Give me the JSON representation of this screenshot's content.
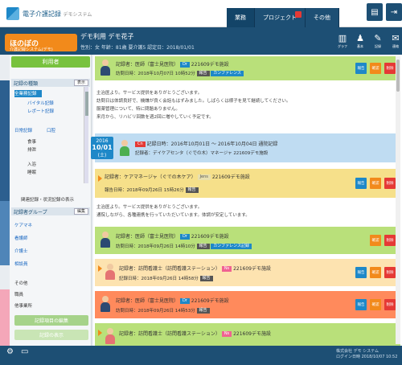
{
  "app": {
    "title": "電子介護記録",
    "subtitle": "デモシステム"
  },
  "tabs": [
    {
      "label": "業務"
    },
    {
      "label": "プロジェクト"
    },
    {
      "label": "その他"
    }
  ],
  "header": {
    "brand": "ほのぼの",
    "brand_sub": "介護記録システム(デモ)",
    "customer_name": "デモ利用 デモ花子",
    "customer_info": "性別：女 年齢：81歳 要介護5 認定日：2018/01/01",
    "icons": [
      {
        "icon": "chart-icon",
        "label": "グラフ"
      },
      {
        "icon": "person-icon",
        "label": "基本"
      },
      {
        "icon": "pen-icon",
        "label": "記録"
      },
      {
        "icon": "mail-icon",
        "label": "連絡"
      }
    ]
  },
  "sidebar": {
    "new_button": "利用者",
    "section1_title": "記録の種類",
    "section1_btn": "表示",
    "items1": [
      "全業務記録",
      "バイタル記録",
      "レポート記録",
      "日常記録",
      "口腔",
      "食事",
      "排泄",
      "入浴",
      "睡眠"
    ],
    "filter_label": "関連記録・状況記録の表示",
    "section2_title": "記録者グループ",
    "section2_btn": "編集",
    "items2": [
      "ケアマネ",
      "看護師",
      "介護士",
      "相談員"
    ],
    "items3": [
      "その他",
      "職員",
      "他事業所"
    ],
    "green1": "記録項目の編集",
    "green2": "記録の表示"
  },
  "timeline": [
    {
      "color": "#b9e07a",
      "l1": "記録者：医師（富士見医院）",
      "tag": "Dr",
      "l1b": "221609デモ施設",
      "l2": "訪問日時：2018年10月07日 10時52分",
      "l2tag": "報告",
      "l2tag2": "カンファレンス"
    },
    {
      "color": "#ffffff",
      "note": true
    },
    {
      "color": "#bfdcf2",
      "l1": "記録日時：2016年10月01日 ～ 2016年10月04日 通院記録",
      "l2": "記録者：デイケアセンタ（ぐでの木）マネージャ",
      "tag": "Cn",
      "l1b": "221609デモ施設"
    },
    {
      "color": "#f6e08a",
      "l1": "記録者：ケアマネージャ（ぐでの木ケア）",
      "tag": "Jens",
      "l1b": "221609デモ施設",
      "l2": "報告日時：2018年09月26日 15時26分",
      "l2tag": "報告"
    },
    {
      "color": "#ffffff",
      "note2": true
    },
    {
      "color": "#b9e07a",
      "l1": "記録者：医師（富士見医院）",
      "tag": "Dr",
      "l1b": "221609デモ施設",
      "l2": "訪問日時：2018年09月26日 14時10分",
      "l2tag": "報告",
      "l2tag2": "カンファレンス記録"
    },
    {
      "color": "#fde3b0",
      "l1": "記録者：訪問看護士（訪問看護ステーション）",
      "tag": "Ns",
      "l1b": "221609デモ施設",
      "l2": "記録日時：2018年09月26日 14時58分",
      "l2tag": "報告"
    },
    {
      "color": "#ff8a5c",
      "l1": "記録者：医師（富士見医院）",
      "tag": "Dr",
      "l1b": "221609デモ施設",
      "l2": "訪問日時：2018年09月26日 14時53分",
      "l2tag": "報告"
    },
    {
      "color": "#b9e07a",
      "l1": "記録者：訪問看護士（訪問看護ステーション）",
      "tag": "Ns",
      "l1b": "221609デモ施設"
    }
  ],
  "notes": {
    "n1": "主治医より。サービス提供をありがとうございます。",
    "n2": "訪問日は体調良好で、機嫌が良く会話もはずみました。しばらくは様子を見て継続してください。",
    "n3": "服薬管理について、特に問題ありません。",
    "n4": "来月から、リハビリ回数を週2回に増やしていく予定です。",
    "m1": "主治医より。サービス提供をありがとうございます。",
    "m2": "通院しながら、各種連携を行っていただいています。体調が安定しています。"
  },
  "datebadge": {
    "year": "2016",
    "date": "10/01",
    "wd": "(土)"
  },
  "row_buttons": {
    "b1": "報告",
    "b2": "確認",
    "b3": "削除"
  },
  "bottom": {
    "line1": "株式会社 デモ システム",
    "line2": "ログイン日時 2018/10/07 10:52"
  },
  "colors": {
    "primary": "#1d4f74",
    "accent": "#f28a1b",
    "green": "#78c23e",
    "blue": "#1e88c8"
  }
}
